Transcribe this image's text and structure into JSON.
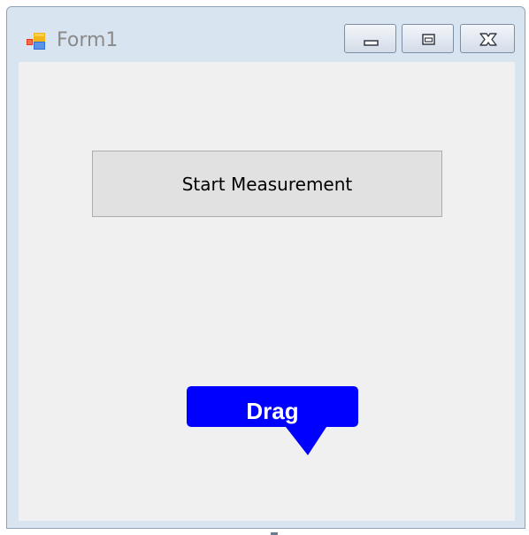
{
  "window": {
    "title": "Form1"
  },
  "titlebar": {
    "minimize_icon": "minimize-icon",
    "maximize_icon": "maximize-icon",
    "close_icon": "close-icon",
    "app_icon": "form-app-icon"
  },
  "main": {
    "start_button_label": "Start Measurement",
    "drag_label": "Drag"
  },
  "colors": {
    "callout": "#0000ff",
    "client_bg": "#f0f0f0",
    "frame": "#d9e4f1"
  }
}
